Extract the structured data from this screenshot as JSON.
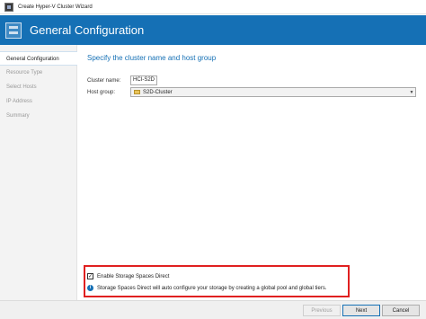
{
  "window": {
    "title": "Create Hyper-V Cluster Wizard"
  },
  "banner": {
    "title": "General Configuration"
  },
  "sidebar": {
    "items": [
      {
        "label": "General Configuration",
        "active": true
      },
      {
        "label": "Resource Type",
        "active": false
      },
      {
        "label": "Select Hosts",
        "active": false
      },
      {
        "label": "IP Address",
        "active": false
      },
      {
        "label": "Summary",
        "active": false
      }
    ]
  },
  "main": {
    "heading": "Specify the cluster name and host group",
    "cluster_name_label": "Cluster name:",
    "cluster_name_value": "HCI-S2D",
    "host_group_label": "Host group:",
    "host_group_value": "S2D-Cluster",
    "storage_checkbox_label": "Enable Storage Spaces Direct",
    "storage_checkbox_checked": true,
    "storage_info_text": "Storage Spaces Direct will auto configure your storage by creating a global pool and global tiers."
  },
  "footer": {
    "previous_label": "Previous",
    "next_label": "Next",
    "cancel_label": "Cancel"
  },
  "colors": {
    "accent": "#1570b5",
    "highlight": "#e02020"
  }
}
